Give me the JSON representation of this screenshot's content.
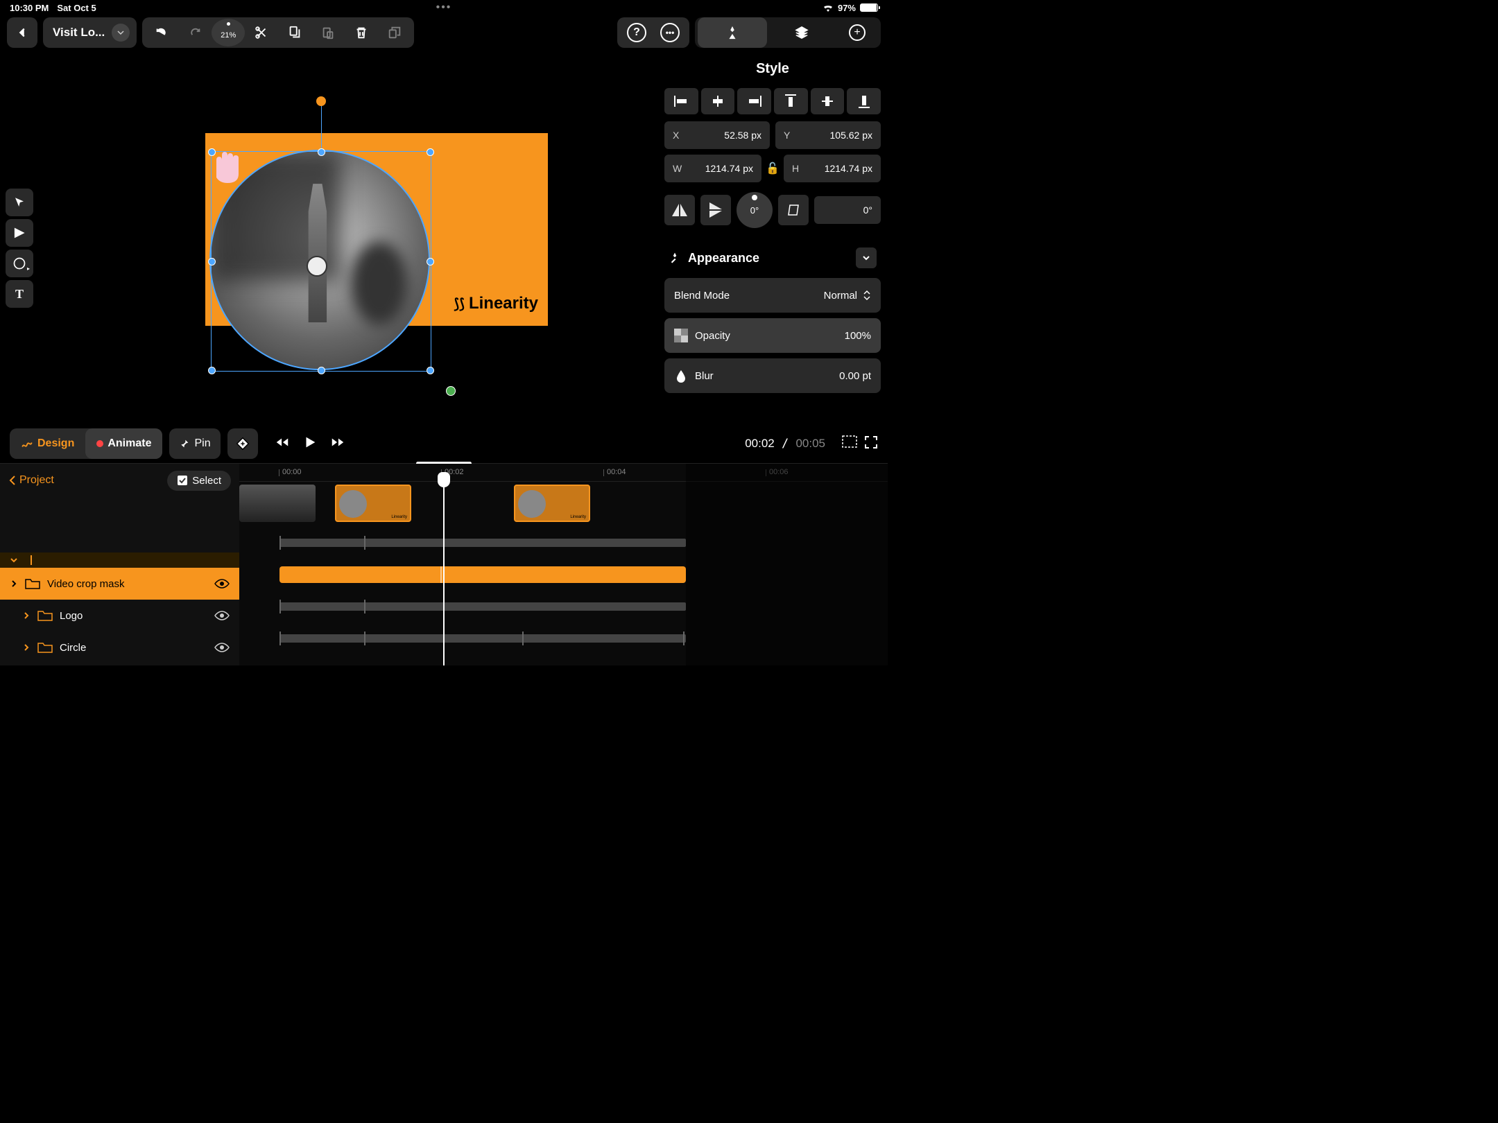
{
  "status": {
    "time": "10:30 PM",
    "date": "Sat Oct 5",
    "battery": "97%"
  },
  "header": {
    "project_title": "Visit Lo...",
    "zoom": "21%"
  },
  "canvas": {
    "logo_text": "Linearity"
  },
  "style_panel": {
    "title": "Style",
    "x_label": "X",
    "x_value": "52.58 px",
    "y_label": "Y",
    "y_value": "105.62 px",
    "w_label": "W",
    "w_value": "1214.74 px",
    "h_label": "H",
    "h_value": "1214.74 px",
    "rotation": "0°",
    "shear": "0°",
    "appearance_title": "Appearance",
    "blend_label": "Blend Mode",
    "blend_value": "Normal",
    "opacity_label": "Opacity",
    "opacity_value": "100%",
    "blur_label": "Blur",
    "blur_value": "0.00 pt"
  },
  "controls": {
    "design": "Design",
    "animate": "Animate",
    "pin": "Pin",
    "current_time": "00:02",
    "total_time": "00:05"
  },
  "timeline": {
    "back": "Project",
    "select": "Select",
    "ticks": [
      "00:00",
      "00:02",
      "00:04",
      "00:06"
    ],
    "layers": [
      {
        "name": "Video crop mask",
        "selected": true
      },
      {
        "name": "Logo",
        "selected": false
      },
      {
        "name": "Circle",
        "selected": false
      }
    ]
  }
}
